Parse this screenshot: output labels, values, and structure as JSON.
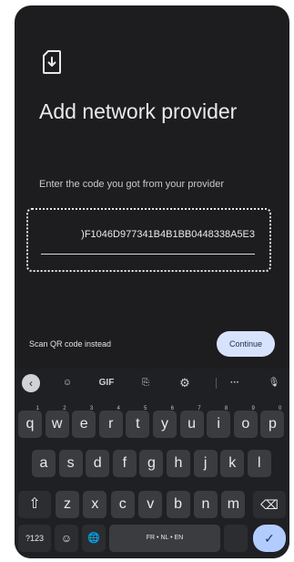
{
  "screen": {
    "title": "Add network provider",
    "subtitle": "Enter the code you got from your provider",
    "code_value": ")F1046D977341B4B1BB0448338A5E3",
    "scan_link": "Scan QR code instead",
    "continue_label": "Continue"
  },
  "keyboard": {
    "toolbar": {
      "back_icon": "‹",
      "sticker_icon": "☺",
      "gif_label": "GIF",
      "translate_icon": "⎘",
      "settings_icon": "⚙",
      "more_icon": "···",
      "mic_icon": "🎙"
    },
    "row1": [
      {
        "k": "q",
        "h": "1"
      },
      {
        "k": "w",
        "h": "2"
      },
      {
        "k": "e",
        "h": "3"
      },
      {
        "k": "r",
        "h": "4"
      },
      {
        "k": "t",
        "h": "5"
      },
      {
        "k": "y",
        "h": "6"
      },
      {
        "k": "u",
        "h": "7"
      },
      {
        "k": "i",
        "h": "8"
      },
      {
        "k": "o",
        "h": "9"
      },
      {
        "k": "p",
        "h": "0"
      }
    ],
    "row2": [
      "a",
      "s",
      "d",
      "f",
      "g",
      "h",
      "j",
      "k",
      "l"
    ],
    "row3": [
      "z",
      "x",
      "c",
      "v",
      "b",
      "n",
      "m"
    ],
    "shift_icon": "⇧",
    "backspace_icon": "⌫",
    "symbols_label": "?123",
    "emoji_icon": "☺",
    "globe_icon": "🌐",
    "space_label": "FR • NL • EN",
    "enter_icon": "✓"
  },
  "colors": {
    "background": "#1d1d1f",
    "accent_button": "#d7e3fc",
    "enter_key": "#b3ccff"
  }
}
